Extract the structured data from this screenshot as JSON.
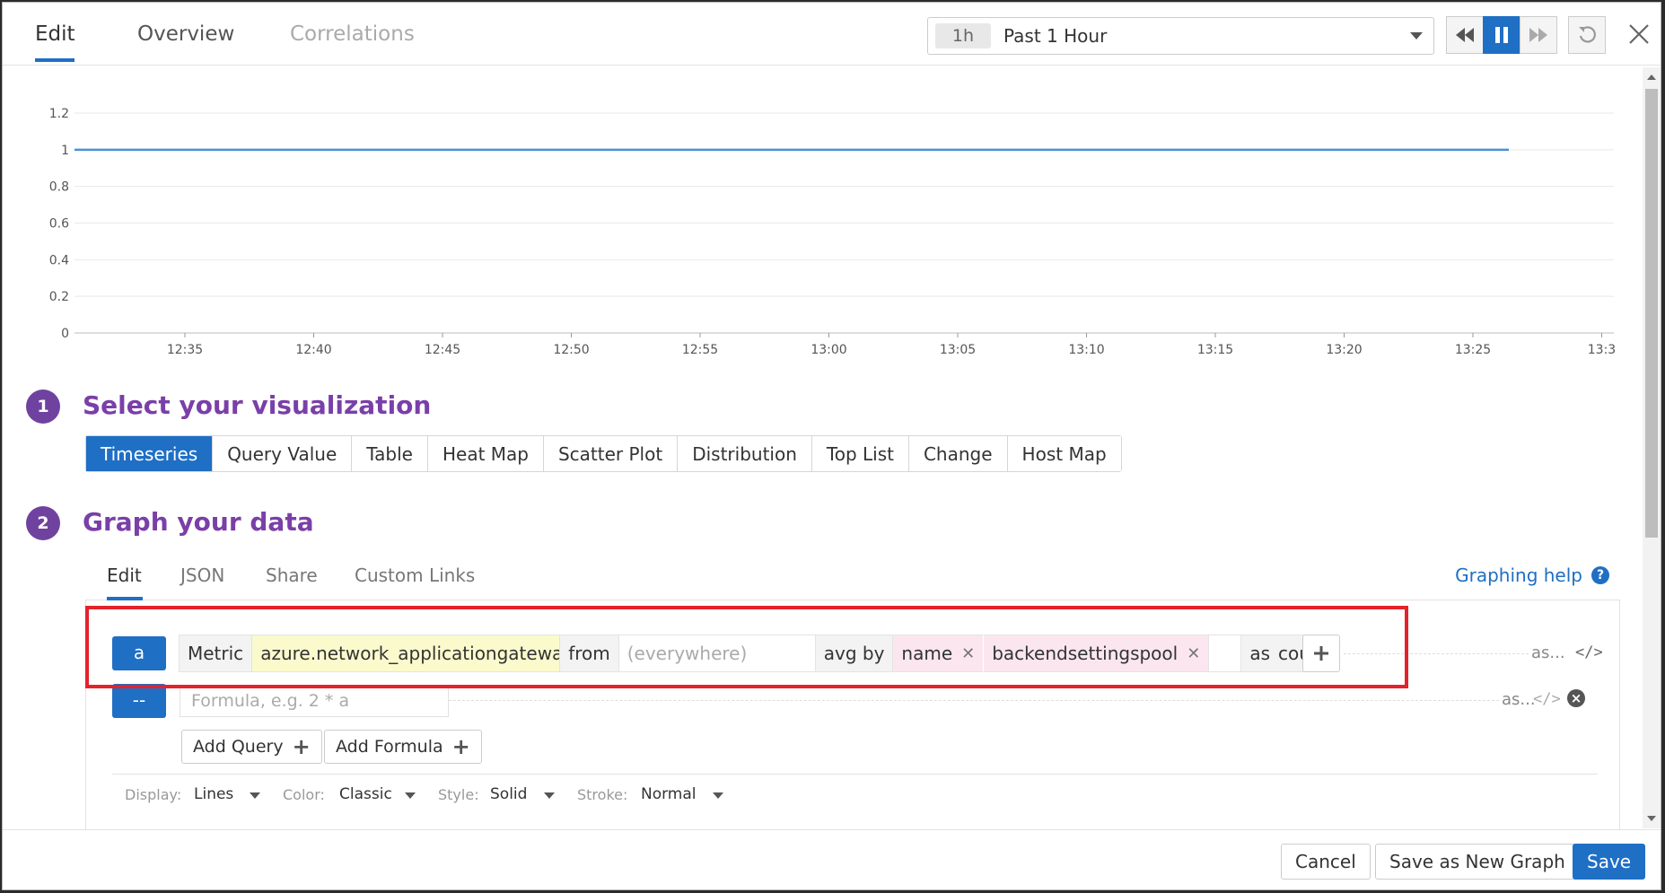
{
  "header": {
    "tabs": [
      {
        "label": "Edit",
        "state": "active"
      },
      {
        "label": "Overview",
        "state": "normal"
      },
      {
        "label": "Correlations",
        "state": "disabled"
      }
    ],
    "time_badge": "1h",
    "time_label": "Past 1 Hour",
    "controls": [
      "rewind-icon",
      "pause-icon",
      "fast-forward-icon",
      "reset-icon",
      "close-icon"
    ]
  },
  "chart_data": {
    "type": "line",
    "x": [
      "12:35",
      "12:40",
      "12:45",
      "12:50",
      "12:55",
      "13:00",
      "13:05",
      "13:10",
      "13:15",
      "13:20",
      "13:25"
    ],
    "series": [
      {
        "values": [
          1,
          1,
          1,
          1,
          1,
          1,
          1,
          1,
          1,
          1,
          1
        ],
        "color": "#4a90d9"
      }
    ],
    "x_tick_labels": [
      "12:35",
      "12:40",
      "12:45",
      "12:50",
      "12:55",
      "13:00",
      "13:05",
      "13:10",
      "13:15",
      "13:20",
      "13:25",
      "13:3"
    ],
    "y_tick_labels": [
      "0",
      "0.2",
      "0.4",
      "0.6",
      "0.8",
      "1",
      "1.2"
    ],
    "ylim": [
      0,
      1.2
    ],
    "grid": true,
    "title": "",
    "xlabel": "",
    "ylabel": ""
  },
  "section1": {
    "number": "1",
    "title": "Select your visualization",
    "options": [
      "Timeseries",
      "Query Value",
      "Table",
      "Heat Map",
      "Scatter Plot",
      "Distribution",
      "Top List",
      "Change",
      "Host Map"
    ],
    "selected": "Timeseries"
  },
  "section2": {
    "number": "2",
    "title": "Graph your data",
    "tabs": [
      "Edit",
      "JSON",
      "Share",
      "Custom Links"
    ],
    "help_label": "Graphing help",
    "help_icon": "?"
  },
  "query": {
    "letter": "a",
    "metric_label": "Metric",
    "metric_value": "azure.network_applicationgatewa...",
    "from_label": "from",
    "from_placeholder": "(everywhere)",
    "avg_label": "avg by",
    "tags": [
      "name",
      "backendsettingspool"
    ],
    "as_label": "as",
    "as_value": "count",
    "alias": "as...",
    "code_icon": "</>"
  },
  "formula": {
    "letter": "--",
    "placeholder": "Formula, e.g. 2 * a",
    "alias": "as...",
    "code_icon": "</>",
    "remove_icon": "×"
  },
  "actions": {
    "add_query": "Add Query",
    "add_formula": "Add Formula"
  },
  "options": {
    "display_label": "Display:",
    "display_value": "Lines",
    "color_label": "Color:",
    "color_value": "Classic",
    "style_label": "Style:",
    "style_value": "Solid",
    "stroke_label": "Stroke:",
    "stroke_value": "Normal"
  },
  "footer": {
    "cancel": "Cancel",
    "save_new": "Save as New Graph",
    "save": "Save"
  },
  "colors": {
    "accent": "#1f6fc5",
    "section_purple": "#7a3fa8",
    "highlight_red": "#e3222b",
    "metric_yellow": "#fbfacc",
    "tag_pink": "#fbe6ef"
  }
}
